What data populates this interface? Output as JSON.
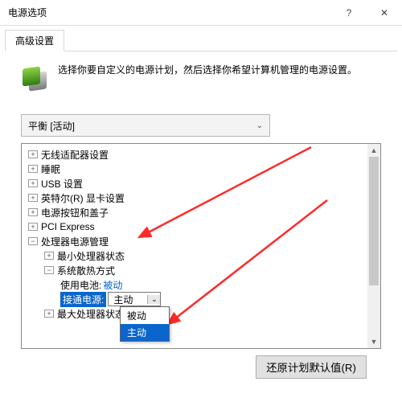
{
  "window": {
    "title": "电源选项",
    "help_glyph": "?",
    "close_glyph": "✕"
  },
  "tab": {
    "advanced": "高级设置"
  },
  "intro": "选择你要自定义的电源计划，然后选择你希望计算机管理的电源设置。",
  "plan": {
    "value": "平衡 [活动]",
    "chevron": "⌄"
  },
  "scroll": {
    "up": "▲",
    "down": "▼"
  },
  "tree": {
    "plus": "+",
    "minus": "−",
    "items": [
      "无线适配器设置",
      "睡眠",
      "USB 设置",
      "英特尔(R) 显卡设置",
      "电源按钮和盖子",
      "PCI Express",
      "处理器电源管理"
    ],
    "cpu": {
      "minState": "最小处理器状态",
      "cooling": "系统散热方式",
      "battery_label": "使用电池:",
      "battery_value": "被动",
      "plugged_label": "接通电源:",
      "plugged_value": "主动",
      "maxState": "最大处理器状态",
      "options": [
        "被动",
        "主动"
      ]
    }
  },
  "footer": {
    "restore": "还原计划默认值(R)"
  }
}
